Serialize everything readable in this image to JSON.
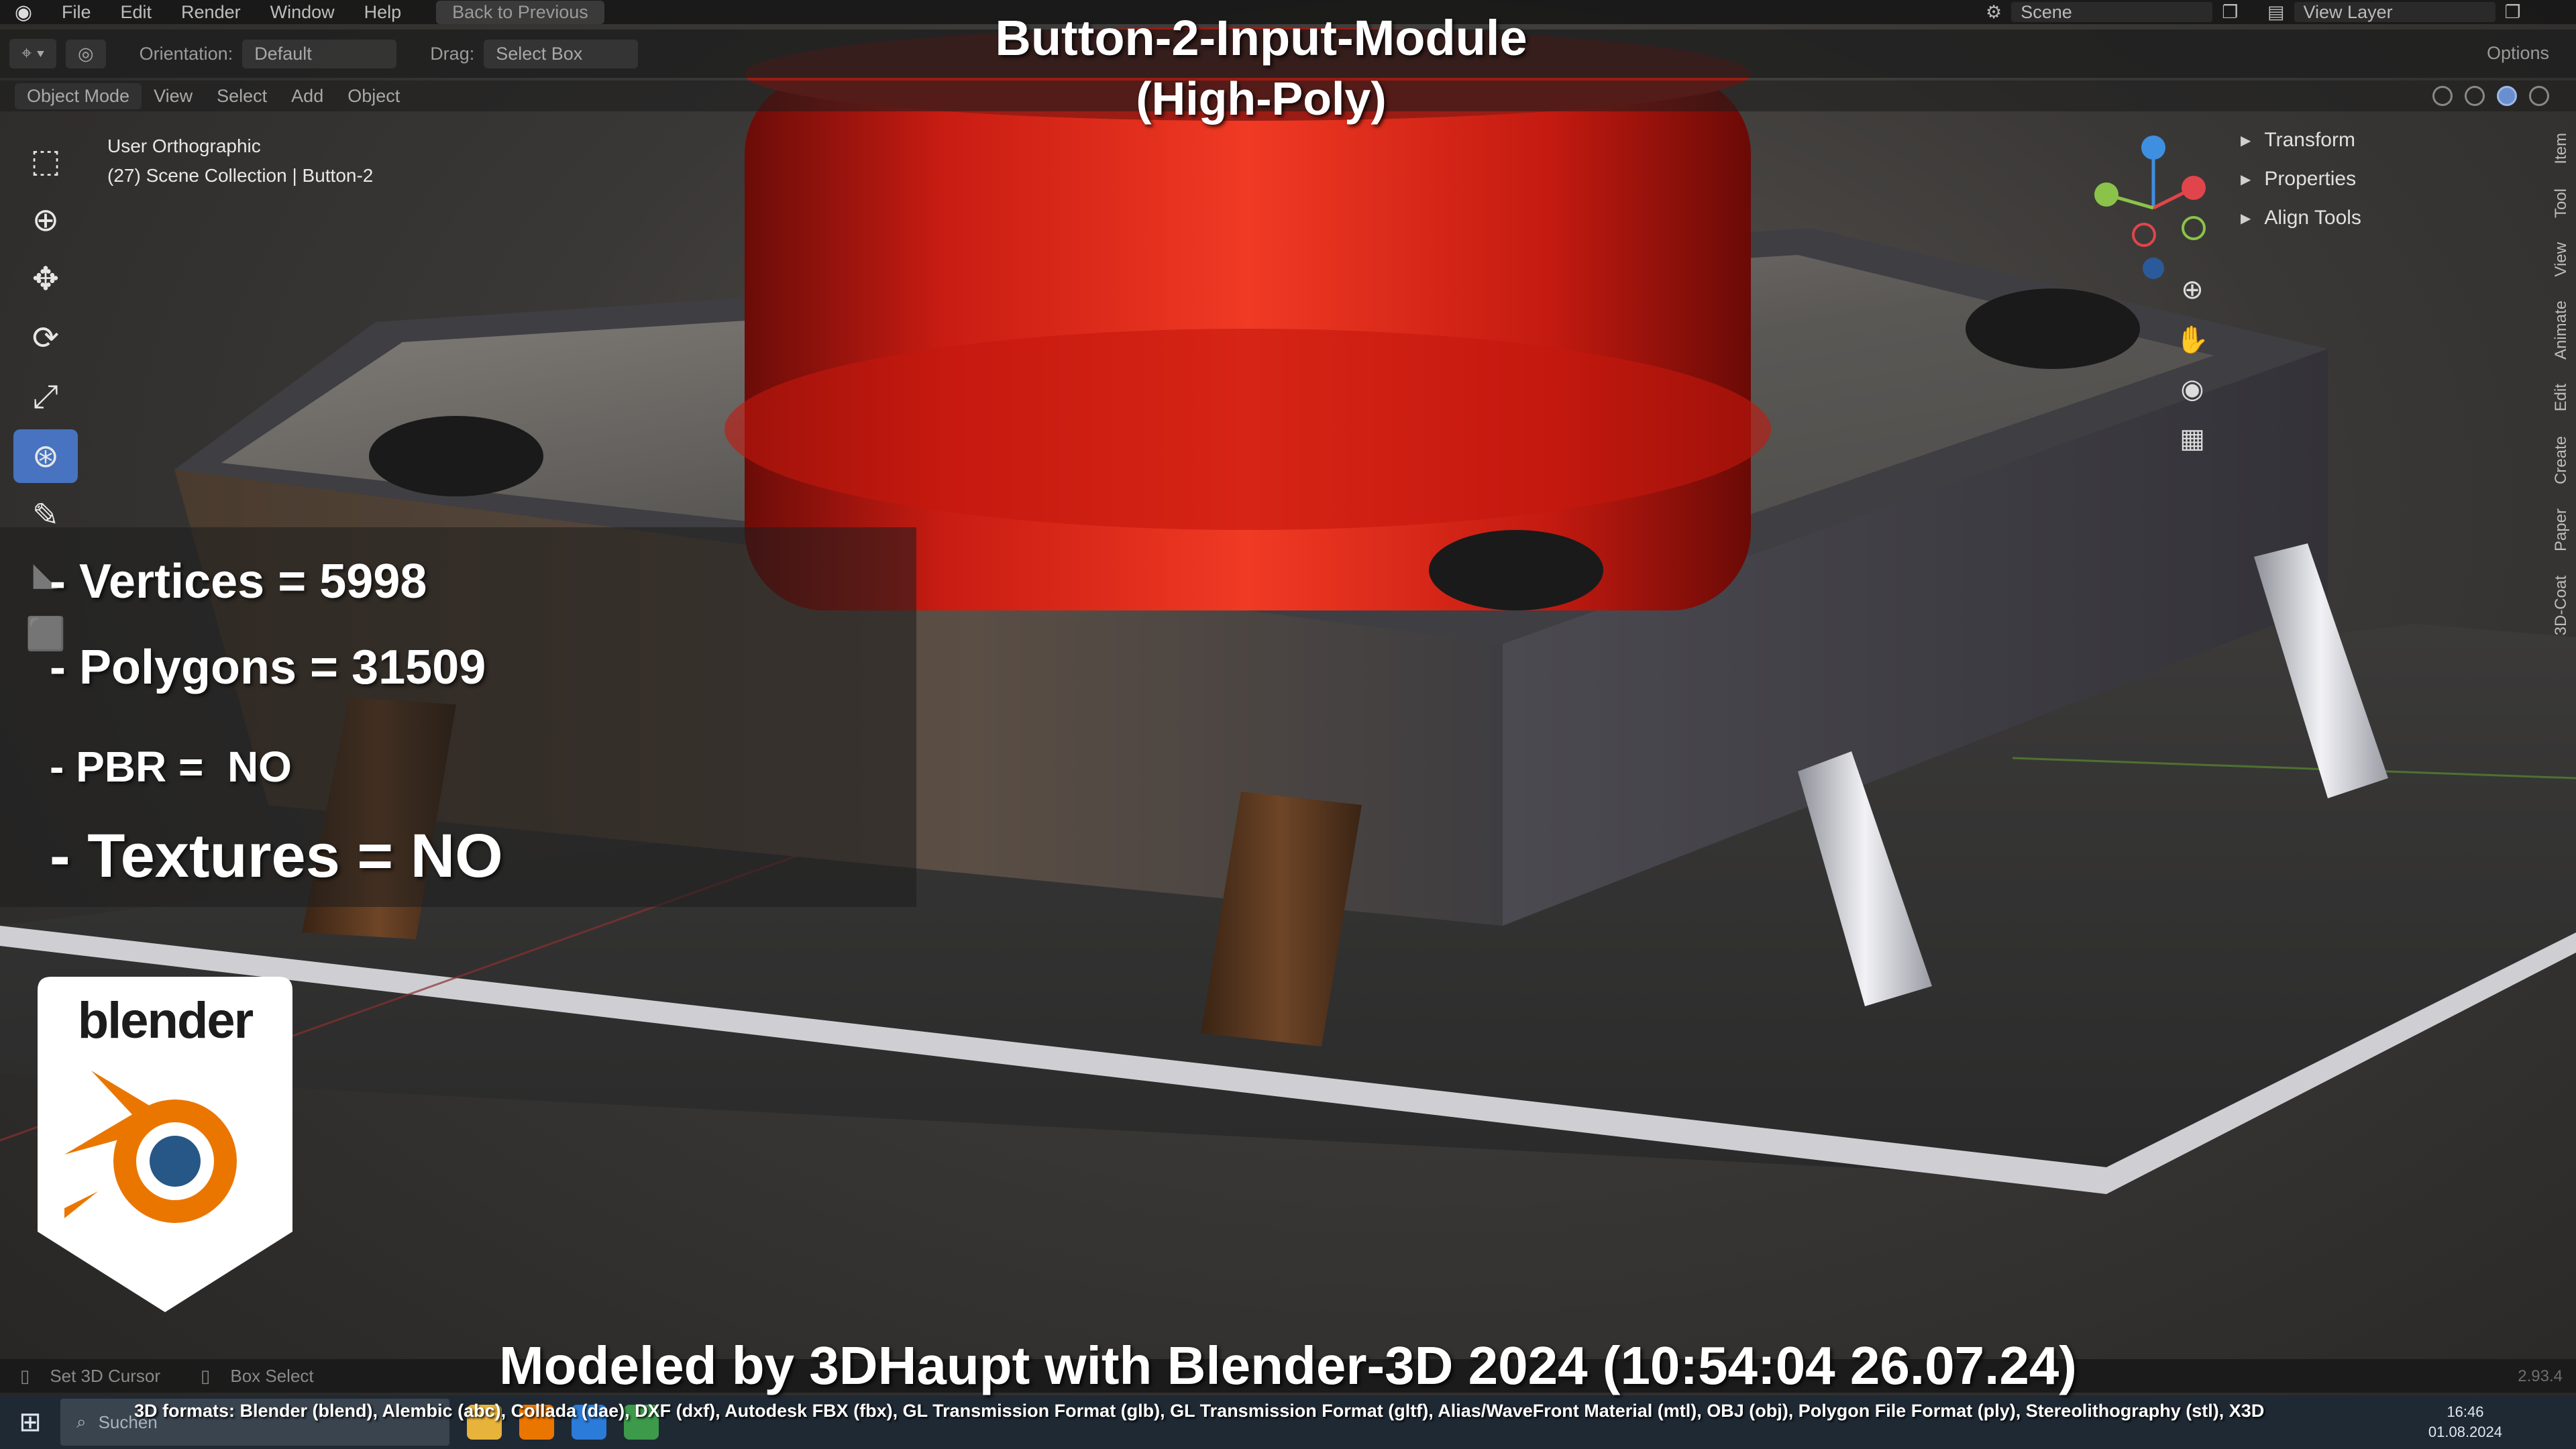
{
  "menubar": {
    "items": [
      "File",
      "Edit",
      "Render",
      "Window",
      "Help"
    ],
    "back_label": "Back to Previous",
    "scene_label": "Scene",
    "view_layer_label": "View Layer"
  },
  "toolbar": {
    "orientation_label": "Orientation:",
    "orientation_value": "Default",
    "drag_label": "Drag:",
    "drag_value": "Select Box",
    "options_label": "Options"
  },
  "header": {
    "mode": "Object Mode",
    "items": [
      "View",
      "Select",
      "Add",
      "Object"
    ]
  },
  "viewport": {
    "view_name": "User Orthographic",
    "collection": "(27) Scene Collection | Button-2"
  },
  "n_panel": {
    "items": [
      "Transform",
      "Properties",
      "Align Tools"
    ]
  },
  "side_tabs": [
    "Item",
    "Tool",
    "View",
    "Animate",
    "Edit",
    "Create",
    "Paper",
    "3D-Coat"
  ],
  "overlay": {
    "title_line1": "Button-2-Input-Module",
    "title_line2": "(High-Poly)",
    "vertices": "- Vertices = 5998",
    "polygons": "- Polygons = 31509",
    "pbr": "- PBR =  NO",
    "textures": "- Textures = NO",
    "logo_word": "blender",
    "credit": "Modeled by 3DHaupt with Blender-3D 2024 (10:54:04  26.07.24)",
    "formats": "3D formats: Blender (blend), Alembic (abc), Collada (dae), DXF (dxf), Autodesk FBX (fbx), GL Transmission Format (glb), GL Transmission Format (gltf), Alias/WaveFront Material (mtl), OBJ (obj), Polygon File Format (ply), Stereolithography (stl), X3D"
  },
  "statusbar": {
    "set_cursor": "Set 3D Cursor",
    "box_select": "Box Select",
    "version": "2.93.4"
  },
  "taskbar": {
    "search_placeholder": "Suchen",
    "time": "16:46",
    "date": "01.08.2024"
  },
  "colors": {
    "accent_blue": "#4773c0",
    "button_red": "#d9261c",
    "axis_x": "#e0454b",
    "axis_y": "#8bc34a",
    "axis_z": "#3f8fe0",
    "blender_orange": "#ea7600",
    "blender_blue": "#265787"
  }
}
